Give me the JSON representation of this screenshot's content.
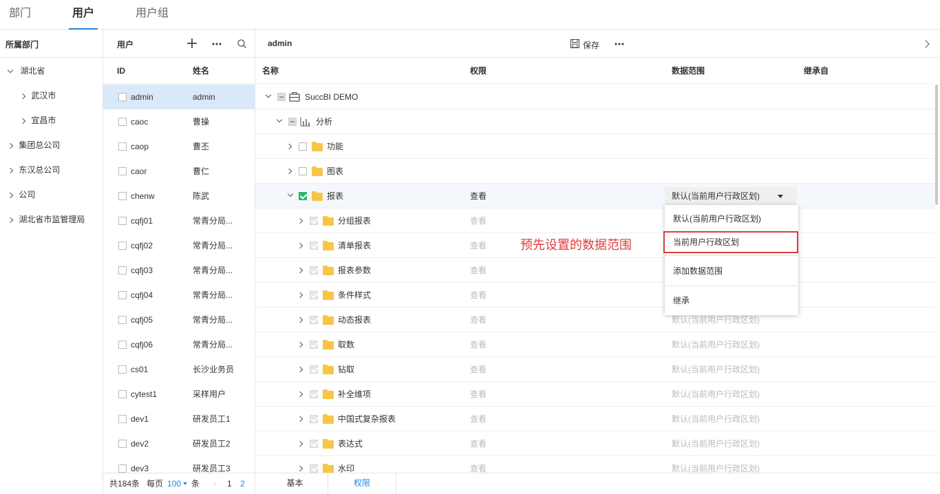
{
  "top_tabs": [
    "部门",
    "用户",
    "用户组"
  ],
  "dept": {
    "title": "所属部门",
    "items": [
      {
        "label": "湖北省",
        "expanded": true
      },
      {
        "label": "武汉市",
        "expanded": false
      },
      {
        "label": "宜昌市",
        "expanded": false
      },
      {
        "label": "集团总公司",
        "expanded": false
      },
      {
        "label": "东汉总公司",
        "expanded": false
      },
      {
        "label": "公司",
        "expanded": false
      },
      {
        "label": "湖北省市监管理局",
        "expanded": false
      }
    ]
  },
  "users": {
    "title": "用户",
    "col_id": "ID",
    "col_name": "姓名",
    "rows": [
      {
        "id": "admin",
        "name": "admin"
      },
      {
        "id": "caoc",
        "name": "曹操"
      },
      {
        "id": "caop",
        "name": "曹丕"
      },
      {
        "id": "caor",
        "name": "曹仁"
      },
      {
        "id": "chenw",
        "name": "陈武"
      },
      {
        "id": "cqfj01",
        "name": "常青分局..."
      },
      {
        "id": "cqfj02",
        "name": "常青分局..."
      },
      {
        "id": "cqfj03",
        "name": "常青分局..."
      },
      {
        "id": "cqfj04",
        "name": "常青分局..."
      },
      {
        "id": "cqfj05",
        "name": "常青分局..."
      },
      {
        "id": "cqfj06",
        "name": "常青分局..."
      },
      {
        "id": "cs01",
        "name": "长沙业务员"
      },
      {
        "id": "cytest1",
        "name": "采样用户"
      },
      {
        "id": "dev1",
        "name": "研发员工1"
      },
      {
        "id": "dev2",
        "name": "研发员工2"
      },
      {
        "id": "dev3",
        "name": "研发员工3"
      }
    ],
    "pager": {
      "total": "共184条",
      "per_page_label": "每页",
      "per_page_value": "100",
      "unit": "条",
      "page1": "1",
      "page2": "2"
    }
  },
  "main": {
    "title": "admin",
    "save_label": "保存",
    "cols": {
      "name": "名称",
      "perm": "权限",
      "scope": "数据范围",
      "inherit": "继承自"
    },
    "rows": [
      {
        "label": "SuccBI DEMO",
        "perm": "",
        "scope": ""
      },
      {
        "label": "分析",
        "perm": "",
        "scope": ""
      },
      {
        "label": "功能",
        "perm": "",
        "scope": ""
      },
      {
        "label": "图表",
        "perm": "",
        "scope": ""
      },
      {
        "label": "报表",
        "perm": "查看",
        "scope": "默认(当前用户行政区划)"
      },
      {
        "label": "分组报表",
        "perm": "查看",
        "scope": ""
      },
      {
        "label": "清单报表",
        "perm": "查看",
        "scope": ""
      },
      {
        "label": "报表参数",
        "perm": "查看",
        "scope": ""
      },
      {
        "label": "条件样式",
        "perm": "查看",
        "scope": ""
      },
      {
        "label": "动态报表",
        "perm": "查看",
        "scope": "默认(当前用户行政区划)"
      },
      {
        "label": "取数",
        "perm": "查看",
        "scope": "默认(当前用户行政区划)"
      },
      {
        "label": "钻取",
        "perm": "查看",
        "scope": "默认(当前用户行政区划)"
      },
      {
        "label": "补全维项",
        "perm": "查看",
        "scope": "默认(当前用户行政区划)"
      },
      {
        "label": "中国式复杂报表",
        "perm": "查看",
        "scope": "默认(当前用户行政区划)"
      },
      {
        "label": "表达式",
        "perm": "查看",
        "scope": "默认(当前用户行政区划)"
      },
      {
        "label": "水印",
        "perm": "查看",
        "scope": "默认(当前用户行政区划)"
      }
    ],
    "dropdown_menu": [
      "默认(当前用户行政区划)",
      "当前用户行政区划",
      "添加数据范围",
      "继承"
    ],
    "annotation": "预先设置的数据范围",
    "bottom_tabs": [
      "基本",
      "权限"
    ]
  },
  "colors": {
    "accent": "#1f86e0",
    "check": "#2bb673",
    "annotation": "#e03b3b",
    "folder": "#f8c547"
  }
}
